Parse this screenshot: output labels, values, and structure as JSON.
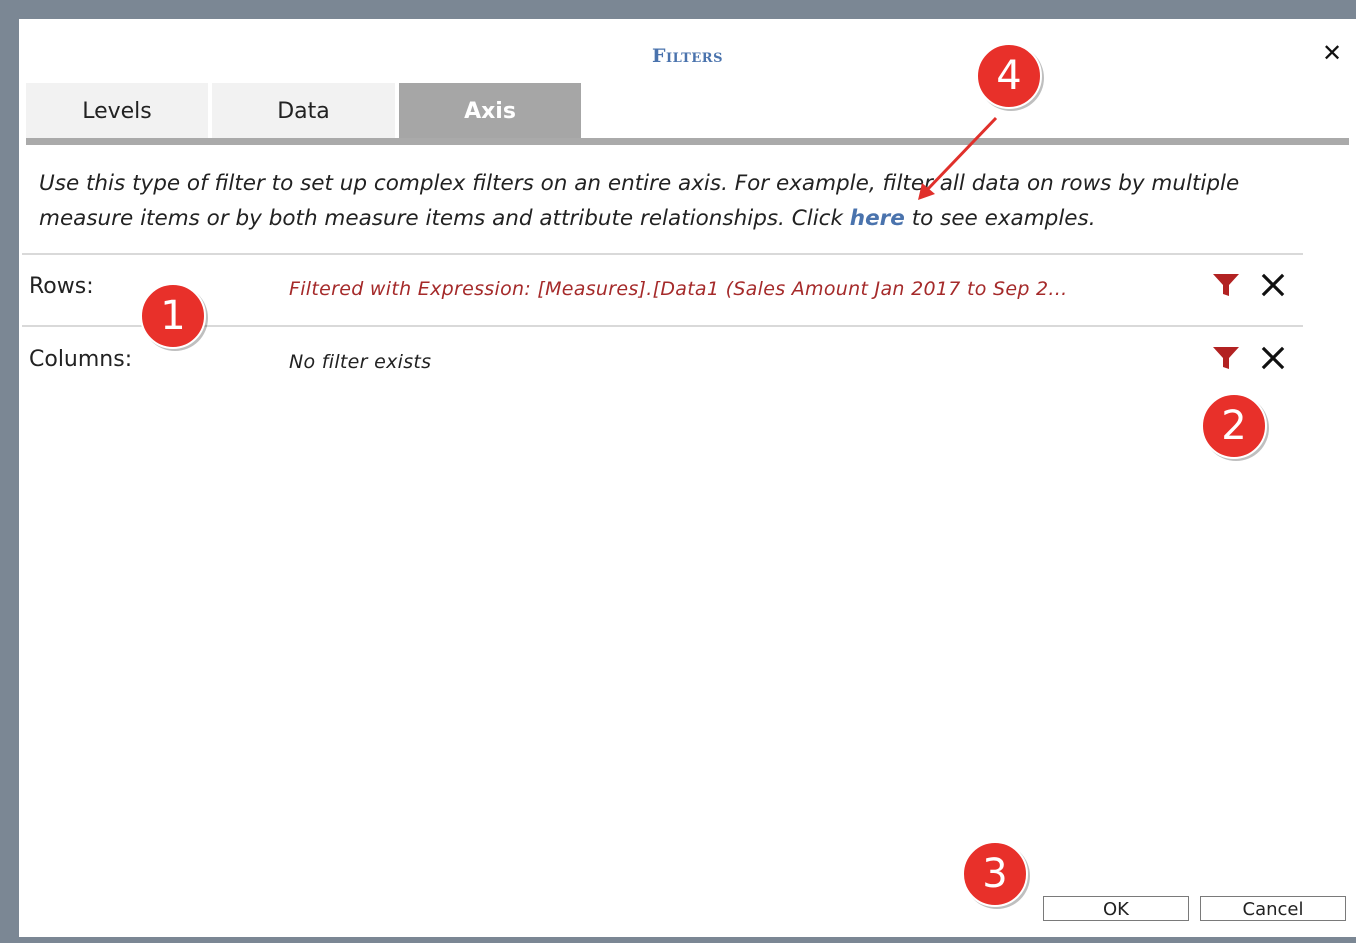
{
  "dialog": {
    "title": "Filters",
    "close_label": "✕"
  },
  "tabs": [
    {
      "label": "Levels",
      "active": false
    },
    {
      "label": "Data",
      "active": false
    },
    {
      "label": "Axis",
      "active": true
    }
  ],
  "description": {
    "part1": "Use this type of filter to set up complex filters on an entire axis. For example, filter all data on rows by multiple measure items or by both measure items and attribute relationships. Click ",
    "link": "here",
    "part2": " to see examples."
  },
  "rows": [
    {
      "label": "Rows:",
      "value": "Filtered with Expression: [Measures].[Data1 (Sales Amount Jan 2017 to Sep 2...",
      "value_color": "#a52a2a"
    },
    {
      "label": "Columns:",
      "value": "No filter exists",
      "value_color": "#222222"
    }
  ],
  "icons": {
    "filter_icon": "funnel-icon",
    "delete_icon": "close-icon",
    "filter_color": "#b22222"
  },
  "buttons": {
    "ok": "OK",
    "cancel": "Cancel"
  },
  "callouts": [
    "1",
    "2",
    "3",
    "4"
  ],
  "colors": {
    "callout": "#e8302a",
    "arrow": "#e0302b",
    "title": "#4a73ad",
    "active_tab": "#a6a6a6"
  }
}
